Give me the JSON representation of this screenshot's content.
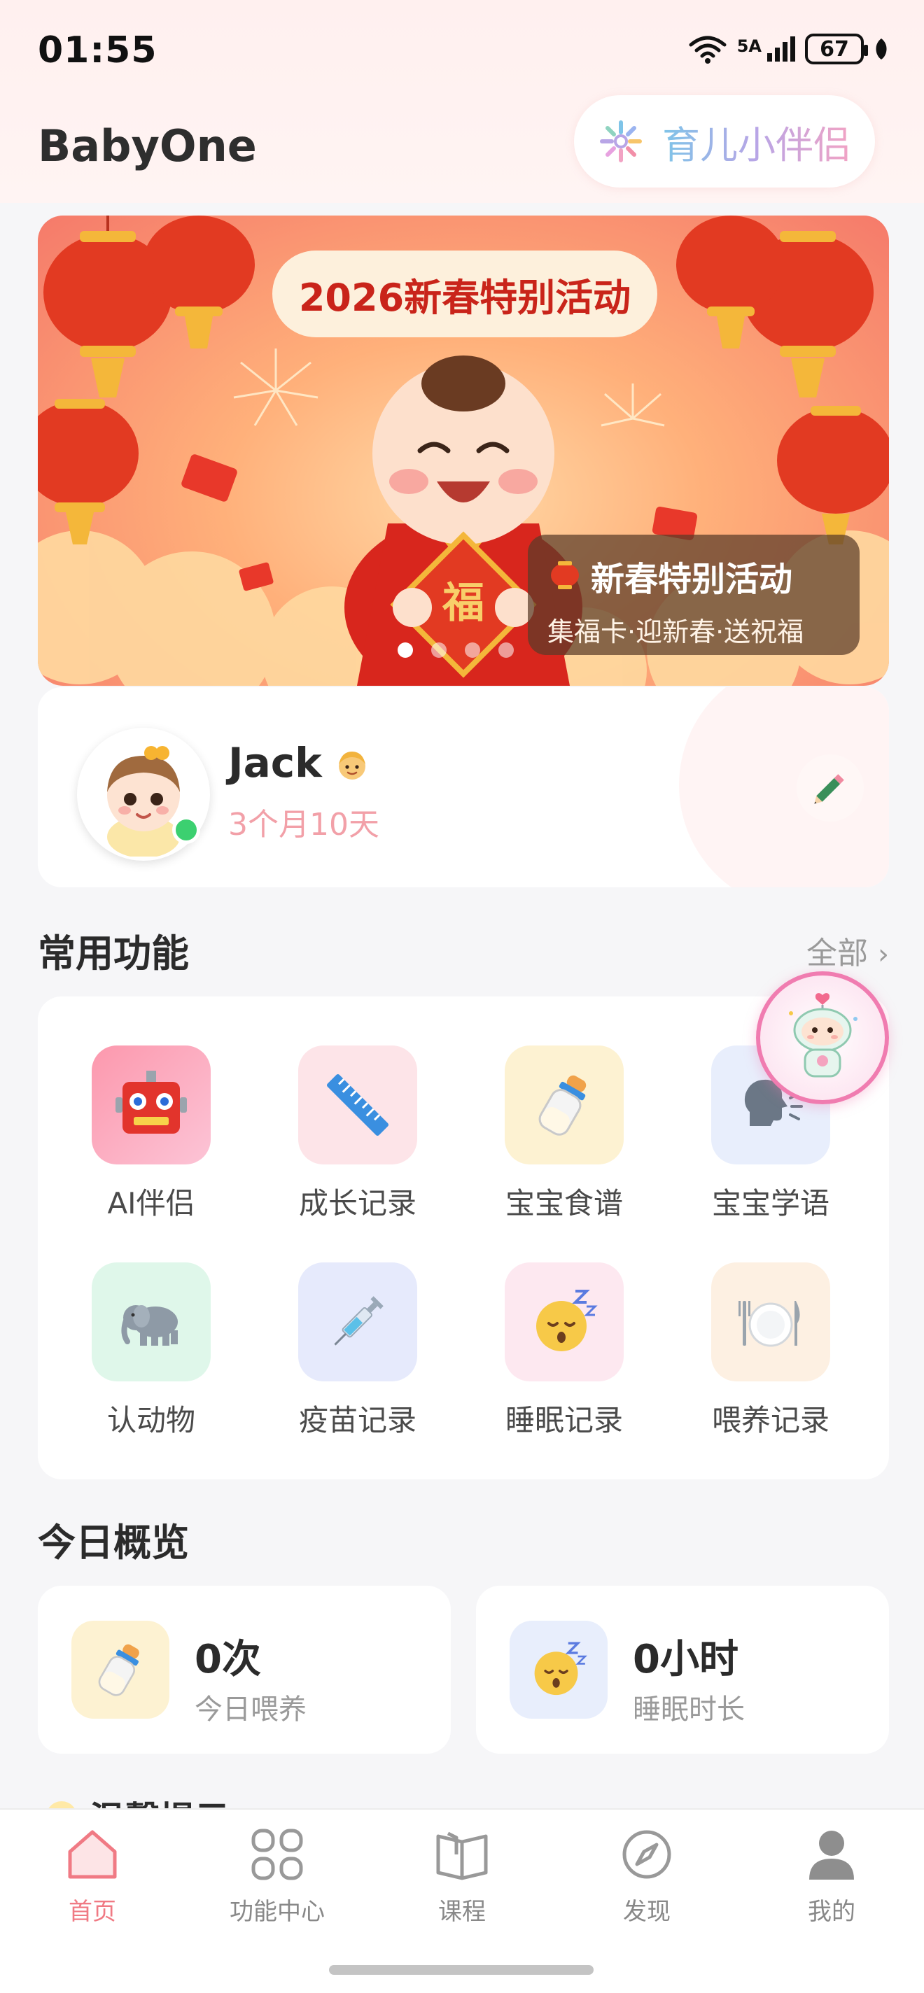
{
  "status_bar": {
    "time": "01:55",
    "network": "5A",
    "battery": "67"
  },
  "header": {
    "app_title": "BabyOne",
    "companion_label": "育儿小伴侣"
  },
  "banner": {
    "title": "2026新春特别活动",
    "badge_title": "新春特别活动",
    "badge_subtitle": "集福卡·迎新春·送祝福",
    "fu_character": "福",
    "slide_count": 4,
    "active_slide": 1
  },
  "profile": {
    "name": "Jack",
    "age": "3个月10天"
  },
  "common_features": {
    "title": "常用功能",
    "more": "全部",
    "items": [
      {
        "label": "AI伴侣",
        "icon": "robot-icon",
        "bg": "#fca6b9"
      },
      {
        "label": "成长记录",
        "icon": "ruler-icon",
        "bg": "#fde4e8"
      },
      {
        "label": "宝宝食谱",
        "icon": "baby-bottle-icon",
        "bg": "#fdf2d2"
      },
      {
        "label": "宝宝学语",
        "icon": "speaking-head-icon",
        "bg": "#e8eefc"
      },
      {
        "label": "认动物",
        "icon": "elephant-icon",
        "bg": "#dff7ea"
      },
      {
        "label": "疫苗记录",
        "icon": "syringe-icon",
        "bg": "#e6eafc"
      },
      {
        "label": "睡眠记录",
        "icon": "sleeping-face-icon",
        "bg": "#fde8f0"
      },
      {
        "label": "喂养记录",
        "icon": "fork-knife-plate-icon",
        "bg": "#fdf0e2"
      }
    ]
  },
  "today": {
    "title": "今日概览",
    "feeding": {
      "value": "0次",
      "label": "今日喂养"
    },
    "sleep": {
      "value": "0小时",
      "label": "睡眠时长"
    }
  },
  "tips": {
    "title": "温馨提示"
  },
  "bottom_nav": {
    "items": [
      {
        "label": "首页",
        "icon": "home-icon",
        "active": true
      },
      {
        "label": "功能中心",
        "icon": "grid-icon",
        "active": false
      },
      {
        "label": "课程",
        "icon": "book-icon",
        "active": false
      },
      {
        "label": "发现",
        "icon": "compass-icon",
        "active": false
      },
      {
        "label": "我的",
        "icon": "profile-icon",
        "active": false
      }
    ]
  },
  "colors": {
    "accent_pink": "#f07a84",
    "online_green": "#3cd070",
    "banner_red": "#c9241a"
  }
}
